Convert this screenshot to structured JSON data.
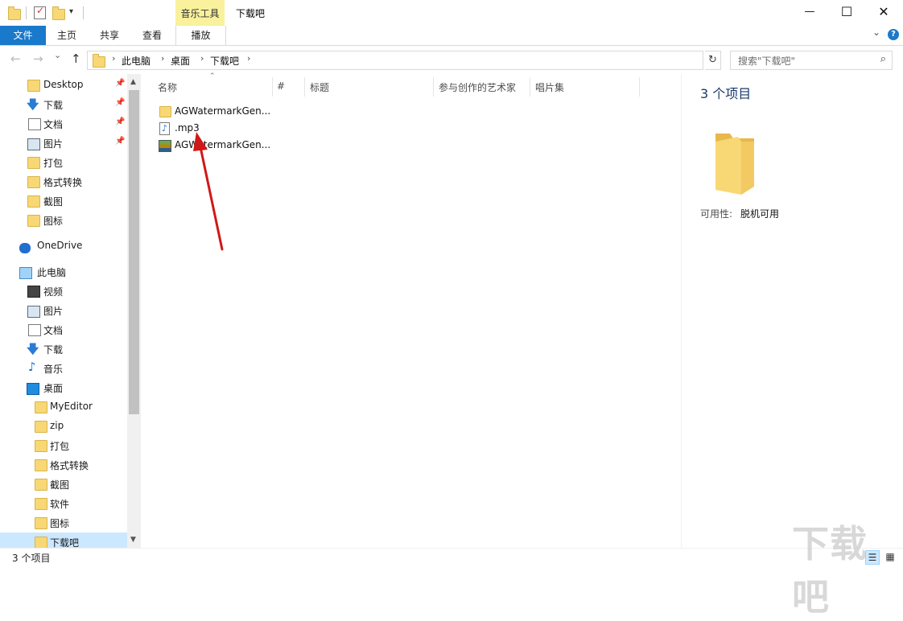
{
  "titlebar": {
    "context_tab": "音乐工具",
    "window_title": "下载吧",
    "minimize": "—",
    "maximize": "☐",
    "close": "✕"
  },
  "ribbon": {
    "tabs": [
      "文件",
      "主页",
      "共享",
      "查看",
      "播放"
    ],
    "collapse": "⌄",
    "help": "?"
  },
  "address": {
    "back": "←",
    "forward": "→",
    "recent": "⌄",
    "up": "↑",
    "crumbs": [
      "此电脑",
      "桌面",
      "下载吧"
    ],
    "sep": "›",
    "refresh": "↻",
    "search_placeholder": "搜索\"下载吧\"",
    "search_icon": "⌕"
  },
  "nav": {
    "quick_access": [
      {
        "label": "Desktop",
        "icon": "folder-icon",
        "pinned": true
      },
      {
        "label": "下载",
        "icon": "download-icon",
        "pinned": true
      },
      {
        "label": "文档",
        "icon": "document-icon",
        "pinned": true
      },
      {
        "label": "图片",
        "icon": "picture-icon",
        "pinned": true
      },
      {
        "label": "打包",
        "icon": "folder-icon",
        "pinned": false
      },
      {
        "label": "格式转换",
        "icon": "folder-icon",
        "pinned": false
      },
      {
        "label": "截图",
        "icon": "folder-icon",
        "pinned": false
      },
      {
        "label": "图标",
        "icon": "folder-icon",
        "pinned": false
      }
    ],
    "onedrive": "OneDrive",
    "this_pc": "此电脑",
    "pc_items": [
      {
        "label": "视频",
        "icon": "video-icon"
      },
      {
        "label": "图片",
        "icon": "picture-icon"
      },
      {
        "label": "文档",
        "icon": "document-icon"
      },
      {
        "label": "下载",
        "icon": "download-icon"
      },
      {
        "label": "音乐",
        "icon": "music-icon"
      },
      {
        "label": "桌面",
        "icon": "desktop-icon"
      }
    ],
    "desktop_children": [
      "MyEditor",
      "zip",
      "打包",
      "格式转换",
      "截图",
      "软件",
      "图标",
      "下载吧"
    ],
    "selected": "下载吧",
    "pin_glyph": "📌"
  },
  "columns": [
    "名称",
    "#",
    "标题",
    "参与创作的艺术家",
    "唱片集"
  ],
  "files": [
    {
      "name": "AGWatermarkGen...",
      "icon": "folder-icon"
    },
    {
      "name": ".mp3",
      "icon": "audio-file-icon"
    },
    {
      "name": "AGWatermarkGen...",
      "icon": "archive-icon"
    }
  ],
  "details": {
    "count": "3 个项目",
    "availability_label": "可用性:",
    "availability_value": "脱机可用"
  },
  "status": {
    "text": "3 个项目"
  },
  "watermark": "下载吧",
  "colors": {
    "accent": "#1979ca",
    "context_tab": "#f9f19c",
    "selection": "#cce8ff",
    "annotation_arrow": "#d01818"
  }
}
